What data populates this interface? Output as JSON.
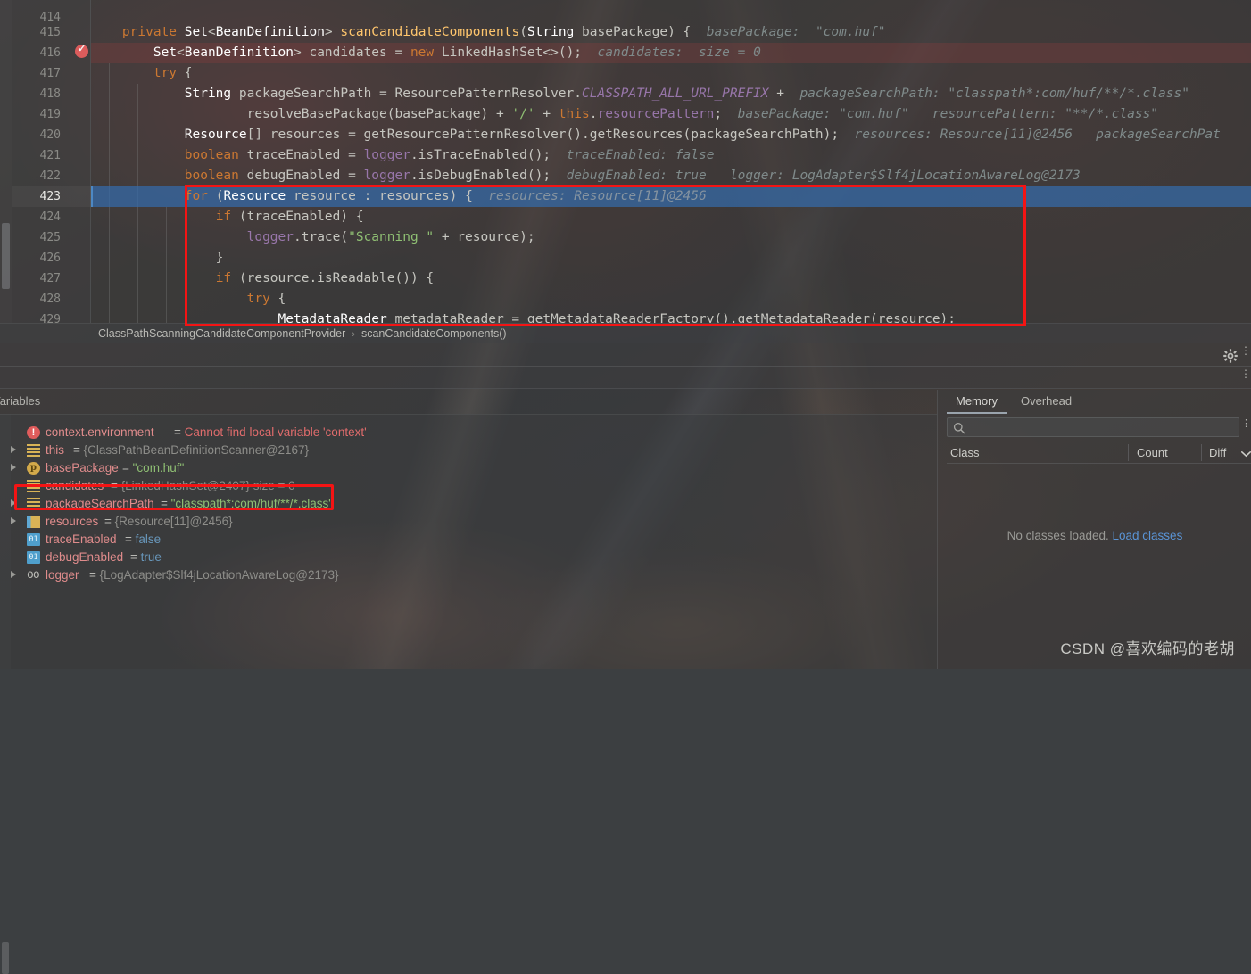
{
  "editor": {
    "line_numbers": [
      "414",
      "415",
      "416",
      "417",
      "418",
      "419",
      "420",
      "421",
      "422",
      "423",
      "424",
      "425",
      "426",
      "427",
      "428",
      "429"
    ],
    "current_line": "423",
    "breakpoint_line": "416",
    "lines": [
      {
        "n": "414",
        "tokens": []
      },
      {
        "n": "415",
        "text": "    private Set<BeanDefinition> scanCandidateComponents(String basePackage) {",
        "hint": "basePackage:  \"com.huf\""
      },
      {
        "n": "416",
        "text": "        Set<BeanDefinition> candidates = new LinkedHashSet<>();",
        "hint": "candidates:  size = 0"
      },
      {
        "n": "417",
        "text": "        try {",
        "hint": ""
      },
      {
        "n": "418",
        "text": "            String packageSearchPath = ResourcePatternResolver.CLASSPATH_ALL_URL_PREFIX +",
        "hint": "packageSearchPath: \"classpath*:com/huf/**/*.class\""
      },
      {
        "n": "419",
        "text": "                    resolveBasePackage(basePackage) + '/' + this.resourcePattern;",
        "hint": "basePackage: \"com.huf\"   resourcePattern: \"**/*.class\""
      },
      {
        "n": "420",
        "text": "            Resource[] resources = getResourcePatternResolver().getResources(packageSearchPath);",
        "hint": "resources: Resource[11]@2456   packageSearchPat"
      },
      {
        "n": "421",
        "text": "            boolean traceEnabled = logger.isTraceEnabled();",
        "hint": "traceEnabled: false"
      },
      {
        "n": "422",
        "text": "            boolean debugEnabled = logger.isDebugEnabled();",
        "hint": "debugEnabled: true   logger: LogAdapter$Slf4jLocationAwareLog@2173"
      },
      {
        "n": "423",
        "text": "            for (Resource resource : resources) {",
        "hint": "resources: Resource[11]@2456"
      },
      {
        "n": "424",
        "text": "                if (traceEnabled) {",
        "hint": ""
      },
      {
        "n": "425",
        "text": "                    logger.trace(\"Scanning \" + resource);",
        "hint": ""
      },
      {
        "n": "426",
        "text": "                }",
        "hint": ""
      },
      {
        "n": "427",
        "text": "                if (resource.isReadable()) {",
        "hint": ""
      },
      {
        "n": "428",
        "text": "                    try {",
        "hint": ""
      },
      {
        "n": "429",
        "text": "                        MetadataReader metadataReader = getMetadataReaderFactory().getMetadataReader(resource);",
        "hint": ""
      }
    ]
  },
  "breadcrumb": {
    "class": "ClassPathScanningCandidateComponentProvider",
    "separator": "›",
    "method": "scanCandidateComponents()"
  },
  "toolbar": {
    "gear_icon": "gear-icon",
    "more_icon": "⋮"
  },
  "debugger": {
    "variables_tab": "Variables",
    "variables": [
      {
        "expandable": false,
        "icon": "error",
        "name": "context.environment",
        "eq": " = ",
        "value": "Cannot find local variable 'context'",
        "value_kind": "err"
      },
      {
        "expandable": true,
        "icon": "field",
        "name": "this",
        "eq": " = ",
        "value": "{ClassPathBeanDefinitionScanner@2167}",
        "value_kind": "obj"
      },
      {
        "expandable": true,
        "icon": "param",
        "name": "basePackage",
        "eq": " = ",
        "value": "\"com.huf\"",
        "value_kind": "str"
      },
      {
        "expandable": false,
        "icon": "field",
        "name": "candidates",
        "eq": " = ",
        "value": "{LinkedHashSet@2407}  size = 0",
        "value_kind": "obj"
      },
      {
        "expandable": true,
        "icon": "field",
        "name": "packageSearchPath",
        "eq": " = ",
        "value": "\"classpath*:com/huf/**/*.class\"",
        "value_kind": "str"
      },
      {
        "expandable": true,
        "icon": "list",
        "name": "resources",
        "eq": " = ",
        "value": "{Resource[11]@2456}",
        "value_kind": "obj"
      },
      {
        "expandable": false,
        "icon": "bool",
        "name": "traceEnabled",
        "eq": " = ",
        "value": "false",
        "value_kind": "num"
      },
      {
        "expandable": false,
        "icon": "bool",
        "name": "debugEnabled",
        "eq": " = ",
        "value": "true",
        "value_kind": "num"
      },
      {
        "expandable": true,
        "icon": "static",
        "name": "logger",
        "eq": " = ",
        "value": "{LogAdapter$Slf4jLocationAwareLog@2173}",
        "value_kind": "obj"
      }
    ]
  },
  "memory": {
    "tabs": [
      {
        "label": "Memory",
        "active": true
      },
      {
        "label": "Overhead",
        "active": false
      }
    ],
    "search_placeholder": "",
    "search_icon": "search-icon",
    "columns": [
      {
        "label": "Class"
      },
      {
        "label": "Count"
      },
      {
        "label": "Diff",
        "sort_icon": "chevron-down-icon"
      }
    ],
    "empty_text": "No classes loaded.",
    "empty_link": "Load classes"
  },
  "annotations": {
    "code_highlight_label": "red-box-code",
    "variable_highlight_label": "red-box-variable",
    "color": "#f41414"
  },
  "watermark": {
    "text": "CSDN @喜欢编码的老胡"
  }
}
